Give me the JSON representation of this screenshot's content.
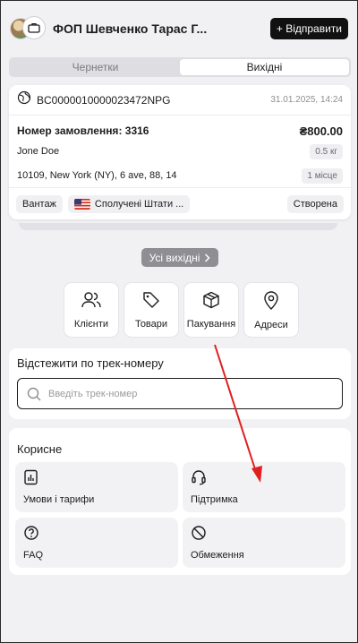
{
  "header": {
    "company_name": "ФОП Шевченко Тарас Г...",
    "send_button": "+ Відправити"
  },
  "tabs": [
    {
      "label": "Чернетки",
      "active": false
    },
    {
      "label": "Вихідні",
      "active": true
    }
  ],
  "order": {
    "tracking_id": "BC0000010000023472NPG",
    "datetime": "31.01.2025, 14:24",
    "order_number": "Номер замовлення: 3316",
    "price": "₴800.00",
    "recipient": "Jone Doe",
    "weight": "0.5 кг",
    "address": "10109, New York (NY), 6 ave, 88, 14",
    "places": "1 місце",
    "type_chip": "Вантаж",
    "country_chip": "Сполучені Штати ...",
    "status_chip": "Створена"
  },
  "all_outgoing_button": "Усі вихідні",
  "quick_actions": [
    {
      "label": "Клієнти",
      "icon": "users-icon"
    },
    {
      "label": "Товари",
      "icon": "tag-icon"
    },
    {
      "label": "Пакування",
      "icon": "box-icon"
    },
    {
      "label": "Адреси",
      "icon": "map-pin-icon"
    }
  ],
  "tracking": {
    "title": "Відстежити по трек-номеру",
    "placeholder": "Введіть трек-номер"
  },
  "useful": {
    "title": "Корисне",
    "items": [
      {
        "label": "Умови і тарифи",
        "icon": "chart-doc-icon"
      },
      {
        "label": "Підтримка",
        "icon": "headset-icon"
      },
      {
        "label": "FAQ",
        "icon": "help-circle-icon"
      },
      {
        "label": "Обмеження",
        "icon": "ban-icon"
      }
    ]
  },
  "colors": {
    "accent_dark": "#111111",
    "annotation_arrow": "#e0201e"
  }
}
